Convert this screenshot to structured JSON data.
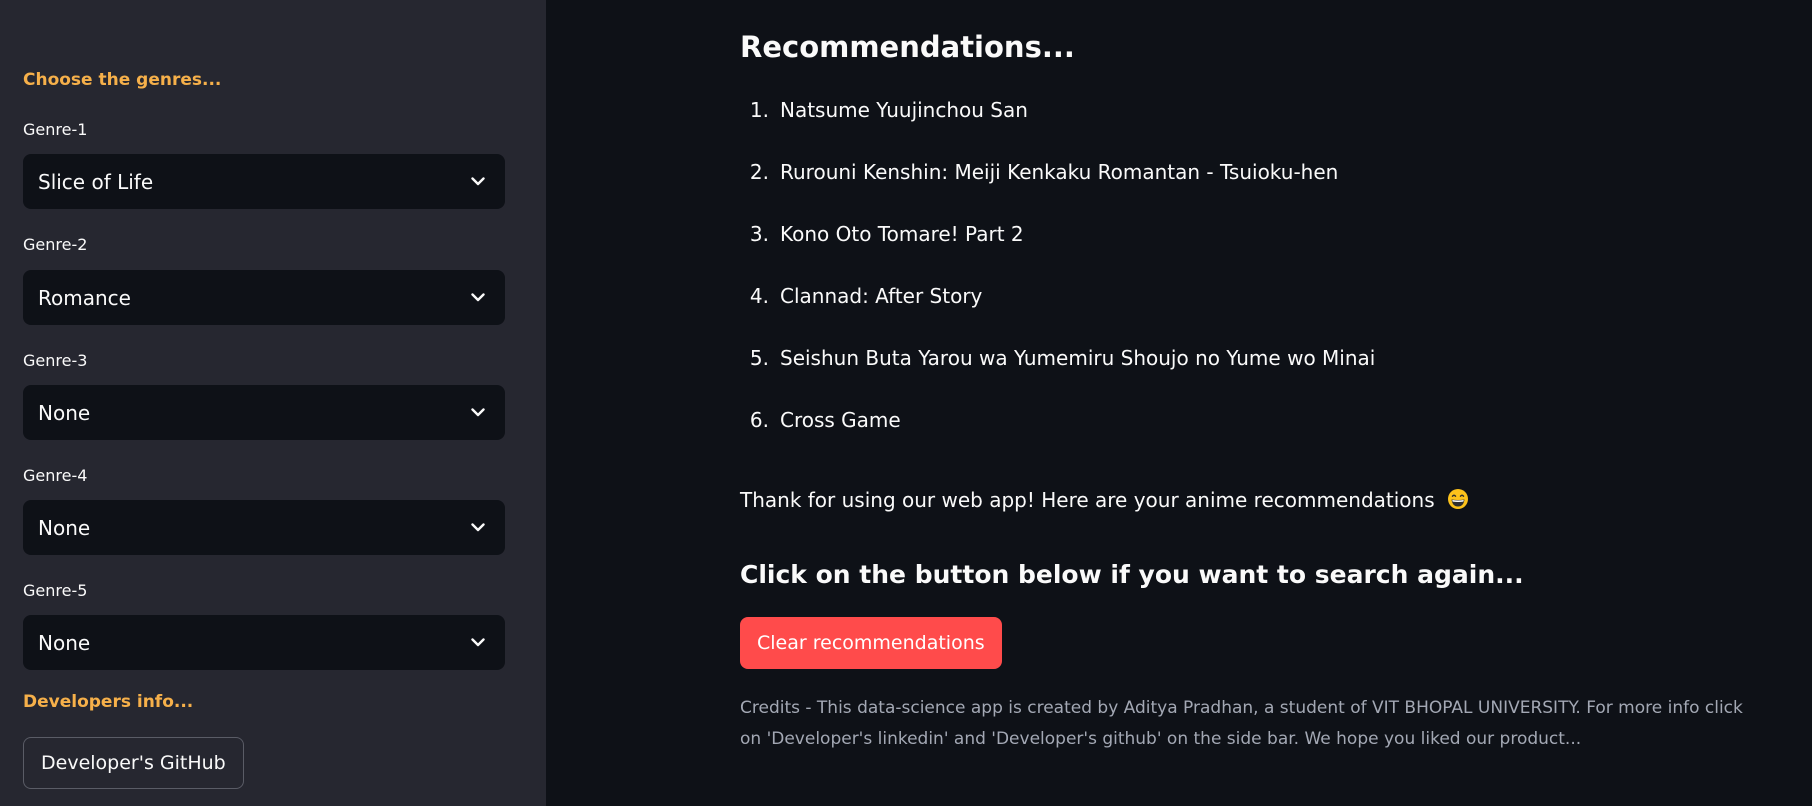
{
  "sidebar": {
    "genres_heading": "Choose the genres...",
    "genres": [
      {
        "label": "Genre-1",
        "value": "Slice of Life"
      },
      {
        "label": "Genre-2",
        "value": "Romance"
      },
      {
        "label": "Genre-3",
        "value": "None"
      },
      {
        "label": "Genre-4",
        "value": "None"
      },
      {
        "label": "Genre-5",
        "value": "None"
      }
    ],
    "developers_heading": "Developers info...",
    "github_button": "Developer's GitHub"
  },
  "main": {
    "recommendations_heading": "Recommendations...",
    "recommendations": [
      {
        "number": "1.",
        "title": "Natsume Yuujinchou San"
      },
      {
        "number": "2.",
        "title": "Rurouni Kenshin: Meiji Kenkaku Romantan - Tsuioku-hen"
      },
      {
        "number": "3.",
        "title": "Kono Oto Tomare! Part 2"
      },
      {
        "number": "4.",
        "title": "Clannad: After Story"
      },
      {
        "number": "5.",
        "title": "Seishun Buta Yarou wa Yumemiru Shoujo no Yume wo Minai"
      },
      {
        "number": "6.",
        "title": "Cross Game"
      }
    ],
    "thanks_text": "Thank for using our web app! Here are your anime recommendations",
    "thanks_icon": "grinning-face-icon",
    "search_again_heading": "Click on the button below if you want to search again...",
    "clear_button": "Clear recommendations",
    "credits_text": "Credits - This data-science app is created by Aditya Pradhan, a student of VIT BHOPAL UNIVERSITY. For more info click on 'Developer's linkedin' and 'Developer's github' on the side bar. We hope you liked our product..."
  },
  "colors": {
    "sidebar_bg": "#262730",
    "main_bg": "#0e1117",
    "accent_heading": "#f6b04a",
    "primary_button": "#ff4b4b",
    "muted_text": "#a3a8b4"
  }
}
